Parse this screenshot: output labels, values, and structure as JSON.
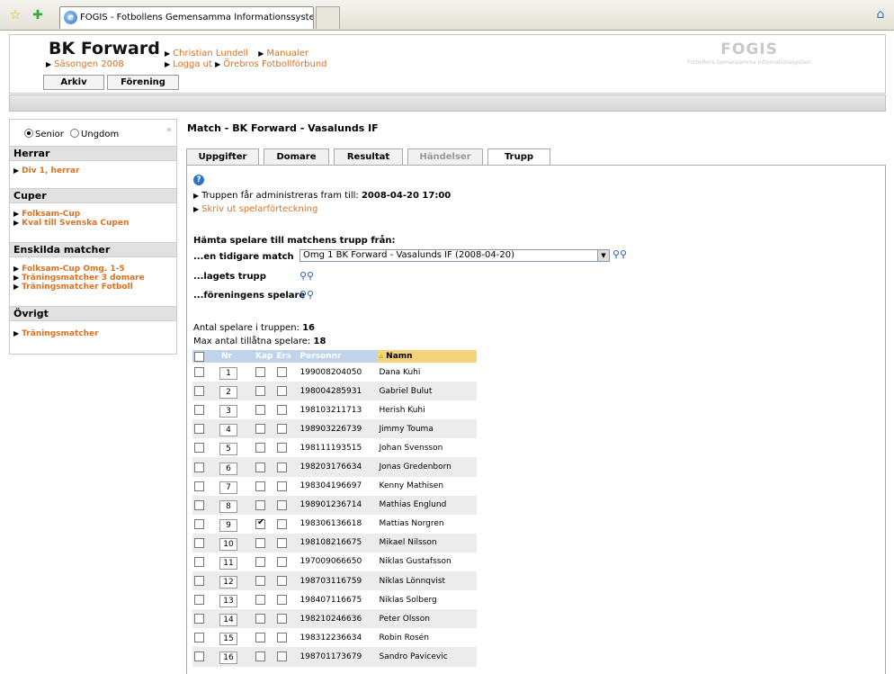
{
  "browser": {
    "tab_title": "FOGIS - Fotbollens Gemensamma Informationssystem"
  },
  "header": {
    "club_name": "BK Forward",
    "season": "Säsongen 2008",
    "links": [
      "Christian Lundell",
      "Manualer",
      "Logga ut",
      "Örebros Fotbollförbund"
    ],
    "logo_title": "FOGIS",
    "logo_subtitle": "Fotbollens Gemensamma Informationssystem",
    "nav_tabs": [
      "Arkiv",
      "Förening"
    ]
  },
  "sidebar": {
    "radio_senior": "Senior",
    "radio_ungdom": "Ungdom",
    "collapse": "«",
    "sections": [
      {
        "title": "Herrar",
        "links": [
          "Div 1, herrar"
        ]
      },
      {
        "title": "Cuper",
        "links": [
          "Folksam-Cup",
          "Kval till Svenska Cupen"
        ]
      },
      {
        "title": "Enskilda matcher",
        "links": [
          "Folksam-Cup Omg. 1-5",
          "Träningsmatcher 3 domare",
          "Träningsmatcher Fotboll"
        ]
      },
      {
        "title": "Övrigt",
        "links": [
          "Träningsmatcher"
        ]
      }
    ]
  },
  "main": {
    "match_title": "Match - BK Forward - Vasalunds IF",
    "tabs": [
      "Uppgifter",
      "Domare",
      "Resultat",
      "Händelser",
      "Trupp"
    ],
    "help_icon": "?",
    "admin_text": "Truppen får administreras fram till:",
    "admin_date": "2008-04-20 17:00",
    "print_link": "Skriv ut spelarförteckning",
    "fetch_heading": "Hämta spelare till matchens trupp från:",
    "fetch_earlier": "...en tidigare match",
    "fetch_select_value": "Omg 1 BK Forward - Vasalunds IF (2008-04-20)",
    "fetch_team": "...lagets trupp",
    "fetch_club": "...föreningens spelare",
    "count_label": "Antal spelare i truppen:",
    "count_value": "16",
    "max_label": "Max antal tillåtna spelare:",
    "max_value": "18"
  },
  "table": {
    "headers": [
      "Nr",
      "Kap",
      "Ers",
      "Personnr",
      "Namn"
    ],
    "rows": [
      {
        "nr": "1",
        "pnr": "199008204050",
        "name": "Dana Kuhi",
        "kap": false
      },
      {
        "nr": "2",
        "pnr": "198004285931",
        "name": "Gabriel Bulut",
        "kap": false
      },
      {
        "nr": "3",
        "pnr": "198103211713",
        "name": "Herish Kuhi",
        "kap": false
      },
      {
        "nr": "4",
        "pnr": "198903226739",
        "name": "Jimmy Touma",
        "kap": false
      },
      {
        "nr": "5",
        "pnr": "198111193515",
        "name": "Johan Svensson",
        "kap": false
      },
      {
        "nr": "6",
        "pnr": "198203176634",
        "name": "Jonas Gredenborn",
        "kap": false
      },
      {
        "nr": "7",
        "pnr": "198304196697",
        "name": "Kenny Mathisen",
        "kap": false
      },
      {
        "nr": "8",
        "pnr": "198901236714",
        "name": "Mathias Englund",
        "kap": false
      },
      {
        "nr": "9",
        "pnr": "198306136618",
        "name": "Mattias Norgren",
        "kap": true
      },
      {
        "nr": "10",
        "pnr": "198108216675",
        "name": "Mikael Nilsson",
        "kap": false
      },
      {
        "nr": "11",
        "pnr": "197009066650",
        "name": "Niklas Gustafsson",
        "kap": false
      },
      {
        "nr": "12",
        "pnr": "198703116759",
        "name": "Niklas Lönnqvist",
        "kap": false
      },
      {
        "nr": "13",
        "pnr": "198407116675",
        "name": "Niklas Solberg",
        "kap": false
      },
      {
        "nr": "14",
        "pnr": "198210246636",
        "name": "Peter Olsson",
        "kap": false
      },
      {
        "nr": "15",
        "pnr": "198312236634",
        "name": "Robin Rosén",
        "kap": false
      },
      {
        "nr": "16",
        "pnr": "198701173679",
        "name": "Sandro Pavicevic",
        "kap": false
      }
    ]
  },
  "colors": {
    "accent_orange": "#e07020",
    "table_header": "#bfd3ea",
    "sorted_header": "#f5d37a"
  }
}
